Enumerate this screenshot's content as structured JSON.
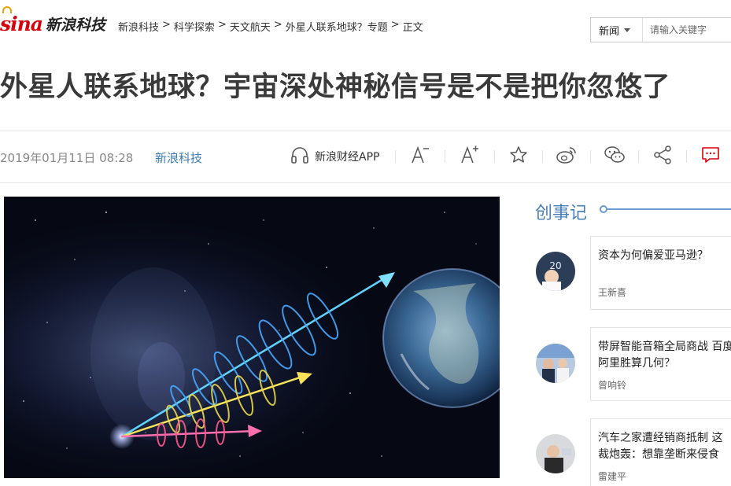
{
  "header": {
    "logo_brand": "sina",
    "logo_text": "新浪科技",
    "breadcrumb": [
      {
        "label": "新浪科技"
      },
      {
        "label": "科学探索"
      },
      {
        "label": "天文航天"
      },
      {
        "label": "外星人联系地球？专题"
      },
      {
        "label": "正文"
      }
    ],
    "crumb_separators": [
      ">",
      ">",
      ">",
      ">"
    ],
    "search": {
      "select_value": "新闻",
      "placeholder": "请输入关键字"
    }
  },
  "article": {
    "title": "外星人联系地球？宇宙深处神秘信号是不是把你忽悠了",
    "date": "2019年01月11日 08:28",
    "source": "新浪科技",
    "tools": {
      "app_label": "新浪财经APP",
      "icons": [
        "headphones-icon",
        "font-decrease-icon",
        "font-increase-icon",
        "star-icon",
        "weibo-icon",
        "wechat-icon",
        "share-icon",
        "comment-icon"
      ]
    }
  },
  "sidebar": {
    "title": "创事记",
    "items": [
      {
        "title_line1": "资本为何偏爱亚马逊？",
        "title_line2": "",
        "author": "王新喜"
      },
      {
        "title_line1": "带屏智能音箱全局商战 百度",
        "title_line2": "阿里胜算几何？",
        "author": "曾响铃"
      },
      {
        "title_line1": "汽车之家遭经销商抵制 这",
        "title_line2": "裁炮轰：想靠垄断来侵食",
        "author": "雷建平"
      }
    ]
  },
  "colors": {
    "brand_red": "#d7000f",
    "link_blue": "#3b7ab5",
    "sidebar_accent": "#4a7fb8",
    "comment_red": "#d7000f"
  }
}
